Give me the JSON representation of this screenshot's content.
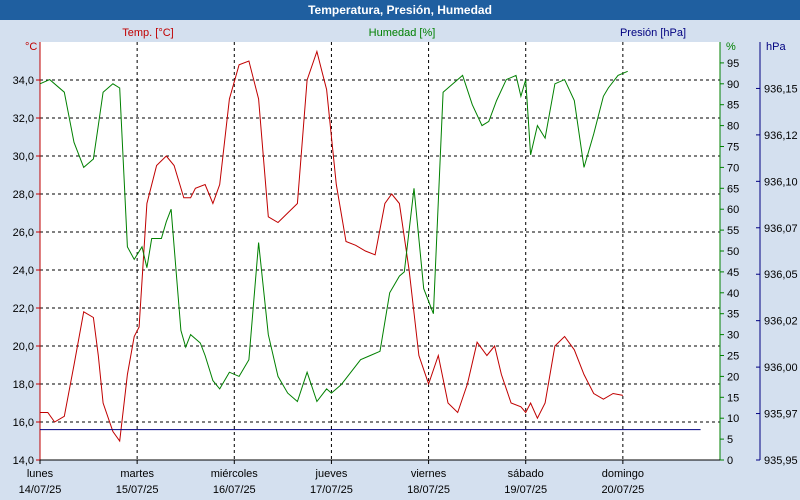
{
  "window": {
    "title": "Temperatura, Presión, Humedad"
  },
  "colors": {
    "temperature": "#c00000",
    "humidity": "#008000",
    "pressure": "#000080",
    "background": "#d4e0ef",
    "plot_area": "#ffffff",
    "title_bar": "#1f5fa0"
  },
  "chart_data": {
    "type": "line",
    "title": "Temperatura, Presión, Humedad",
    "grid": true,
    "x_range": [
      "14/07/25 00:00",
      "21/07/25 00:00"
    ],
    "x_ticks": [
      {
        "day": "lunes",
        "date": "14/07/25"
      },
      {
        "day": "martes",
        "date": "15/07/25"
      },
      {
        "day": "miércoles",
        "date": "16/07/25"
      },
      {
        "day": "jueves",
        "date": "17/07/25"
      },
      {
        "day": "viernes",
        "date": "18/07/25"
      },
      {
        "day": "sábado",
        "date": "19/07/25"
      },
      {
        "day": "domingo",
        "date": "20/07/25"
      }
    ],
    "axes": {
      "temperature": {
        "label": "Temp. [°C]",
        "unit": "°C",
        "range": [
          14,
          36
        ],
        "ticks": [
          "14,0",
          "16,0",
          "18,0",
          "20,0",
          "22,0",
          "24,0",
          "26,0",
          "28,0",
          "30,0",
          "32,0",
          "34,0"
        ]
      },
      "humidity": {
        "label": "Humedad [%]",
        "unit": "%",
        "range": [
          0,
          100
        ],
        "ticks": [
          "0",
          "5",
          "10",
          "15",
          "20",
          "25",
          "30",
          "35",
          "40",
          "45",
          "50",
          "55",
          "60",
          "65",
          "70",
          "75",
          "80",
          "85",
          "90",
          "95"
        ]
      },
      "pressure": {
        "label": "Presión [hPa]",
        "unit": "hPa",
        "range": [
          935.95,
          936.17
        ],
        "ticks": [
          "935,95",
          "935,97",
          "936,00",
          "936,02",
          "936,05",
          "936,07",
          "936,10",
          "936,12",
          "936,15"
        ]
      }
    },
    "series": [
      {
        "name": "Temp. [°C]",
        "axis": "temperature",
        "x_days": [
          0,
          0.08,
          0.15,
          0.25,
          0.35,
          0.45,
          0.55,
          0.6,
          0.65,
          0.75,
          0.82,
          0.9,
          0.97,
          1.02,
          1.1,
          1.2,
          1.3,
          1.38,
          1.48,
          1.55,
          1.6,
          1.7,
          1.78,
          1.85,
          1.95,
          2.05,
          2.15,
          2.25,
          2.35,
          2.45,
          2.55,
          2.65,
          2.75,
          2.85,
          2.9,
          2.95,
          3.05,
          3.15,
          3.25,
          3.35,
          3.45,
          3.55,
          3.62,
          3.7,
          3.8,
          3.9,
          4.0,
          4.1,
          4.2,
          4.3,
          4.4,
          4.5,
          4.6,
          4.68,
          4.75,
          4.85,
          4.95,
          5.0,
          5.05,
          5.12,
          5.2,
          5.3,
          5.4,
          5.5,
          5.6,
          5.7,
          5.8,
          5.9,
          6.0,
          6.1,
          6.2,
          6.3,
          6.38,
          6.45,
          6.55,
          6.62,
          6.68,
          6.75,
          6.8
        ],
        "values": [
          16.5,
          16.5,
          16.0,
          16.3,
          19.0,
          21.8,
          21.5,
          19.5,
          17.0,
          15.5,
          15.0,
          18.5,
          20.5,
          21.0,
          27.5,
          29.5,
          30.0,
          29.5,
          27.8,
          27.8,
          28.3,
          28.5,
          27.5,
          28.5,
          33.0,
          34.8,
          35.0,
          33.0,
          26.8,
          26.5,
          27.0,
          27.5,
          34.0,
          35.5,
          34.5,
          33.5,
          28.5,
          25.5,
          25.3,
          25.0,
          24.8,
          27.5,
          28.0,
          27.5,
          24.0,
          19.5,
          18.0,
          19.5,
          17.0,
          16.5,
          18.0,
          20.2,
          19.5,
          20.0,
          18.5,
          17.0,
          16.8,
          16.5,
          17.0,
          16.2,
          17.0,
          20.0,
          20.5,
          19.8,
          18.5,
          17.5,
          17.2,
          17.5,
          17.4
        ],
        "color": "#c00000"
      },
      {
        "name": "Humedad [%]",
        "axis": "humidity",
        "x_days": [
          0,
          0.1,
          0.25,
          0.35,
          0.45,
          0.55,
          0.6,
          0.65,
          0.75,
          0.82,
          0.9,
          0.97,
          1.05,
          1.1,
          1.15,
          1.25,
          1.3,
          1.35,
          1.45,
          1.5,
          1.55,
          1.6,
          1.65,
          1.7,
          1.78,
          1.85,
          1.95,
          2.05,
          2.15,
          2.25,
          2.35,
          2.45,
          2.55,
          2.65,
          2.75,
          2.85,
          2.95,
          3.0,
          3.1,
          3.2,
          3.3,
          3.4,
          3.5,
          3.6,
          3.7,
          3.75,
          3.85,
          3.95,
          4.05,
          4.15,
          4.25,
          4.35,
          4.45,
          4.55,
          4.62,
          4.7,
          4.8,
          4.9,
          4.95,
          5.0,
          5.05,
          5.12,
          5.2,
          5.3,
          5.4,
          5.5,
          5.6,
          5.7,
          5.8,
          5.85,
          5.95,
          6.05,
          6.15,
          6.25,
          6.35,
          6.45,
          6.55,
          6.65,
          6.75
        ],
        "values": [
          90,
          91,
          88,
          76,
          70,
          72,
          80,
          88,
          90,
          89,
          51,
          48,
          51,
          46,
          53,
          53,
          57,
          60,
          31,
          27,
          30,
          29,
          28,
          25,
          19,
          17,
          21,
          20,
          24,
          52,
          30,
          20,
          16,
          14,
          21,
          14,
          17,
          16,
          18,
          21,
          24,
          25,
          26,
          40,
          44,
          45,
          65,
          41,
          35,
          88,
          90,
          92,
          85,
          80,
          81,
          86,
          91,
          92,
          87,
          91,
          73,
          80,
          77,
          90,
          91,
          86,
          70,
          78,
          87,
          89,
          92,
          93
        ],
        "color": "#008000"
      },
      {
        "name": "Presión [hPa]",
        "axis": "pressure",
        "x_days": [
          0,
          6.8
        ],
        "values": [
          935.966,
          935.966
        ],
        "color": "#000080"
      }
    ]
  }
}
